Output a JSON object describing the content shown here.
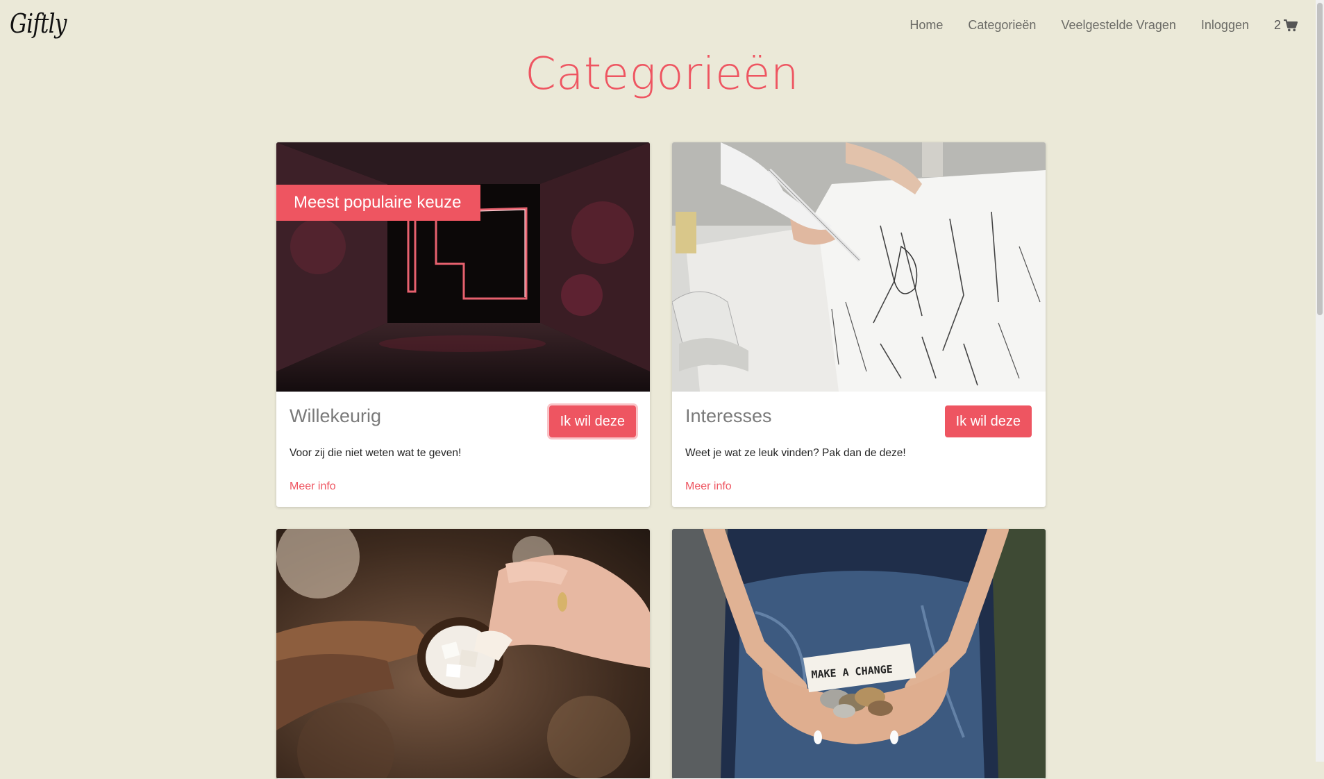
{
  "brand": {
    "logo": "Giftly"
  },
  "nav": {
    "items": [
      "Home",
      "Categorieën",
      "Veelgestelde Vragen",
      "Inloggen"
    ],
    "cart_count": "2"
  },
  "page": {
    "title": "Categorieën"
  },
  "cards": [
    {
      "title": "Willekeurig",
      "button": "Ik wil deze",
      "description": "Voor zij die niet weten wat te geven!",
      "link": "Meer info",
      "ribbon": "Meest populaire keuze",
      "image": "neon-question-mark-tunnel-photo"
    },
    {
      "title": "Interesses",
      "button": "Ik wil deze",
      "description": "Weet je wat ze leuk vinden? Pak dan de deze!",
      "link": "Meer info",
      "image": "fashion-sketching-photo"
    },
    {
      "image": "coconut-hands-photo"
    },
    {
      "image": "make-a-change-coins-photo",
      "image_caption": "MAKE A CHANGE"
    }
  ],
  "colors": {
    "accent": "#ee5561",
    "background": "#ebe9d8",
    "nav_text": "#6b6b66"
  }
}
